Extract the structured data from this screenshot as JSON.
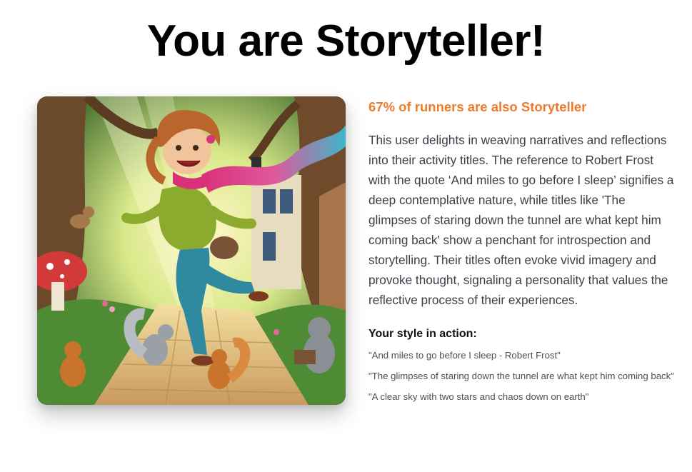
{
  "page": {
    "title": "You are Storyteller!"
  },
  "hero_image": {
    "description_icon": "storyteller-illustration"
  },
  "result": {
    "stat_text": "67% of runners are also Storyteller",
    "description": "This user delights in weaving narratives and reflections into their activity titles. The reference to Robert Frost with the quote ‘And miles to go before I sleep’ signifies a deep contemplative nature, while titles like 'The glimpses of staring down the tunnel are what kept him coming back' show a penchant for introspection and storytelling. Their titles often evoke vivid imagery and provoke thought, signaling a personality that values the reflective process of their experiences.",
    "style_heading": "Your style in action:",
    "quotes": [
      "\"And miles to go before I sleep - Robert Frost\"",
      "\"The glimpses of staring down the tunnel are what kept him coming back\"",
      "\"A clear sky with two stars and chaos down on earth\""
    ]
  },
  "colors": {
    "accent": "#f07a2c",
    "body_text": "#3a3f47",
    "title": "#000000"
  }
}
